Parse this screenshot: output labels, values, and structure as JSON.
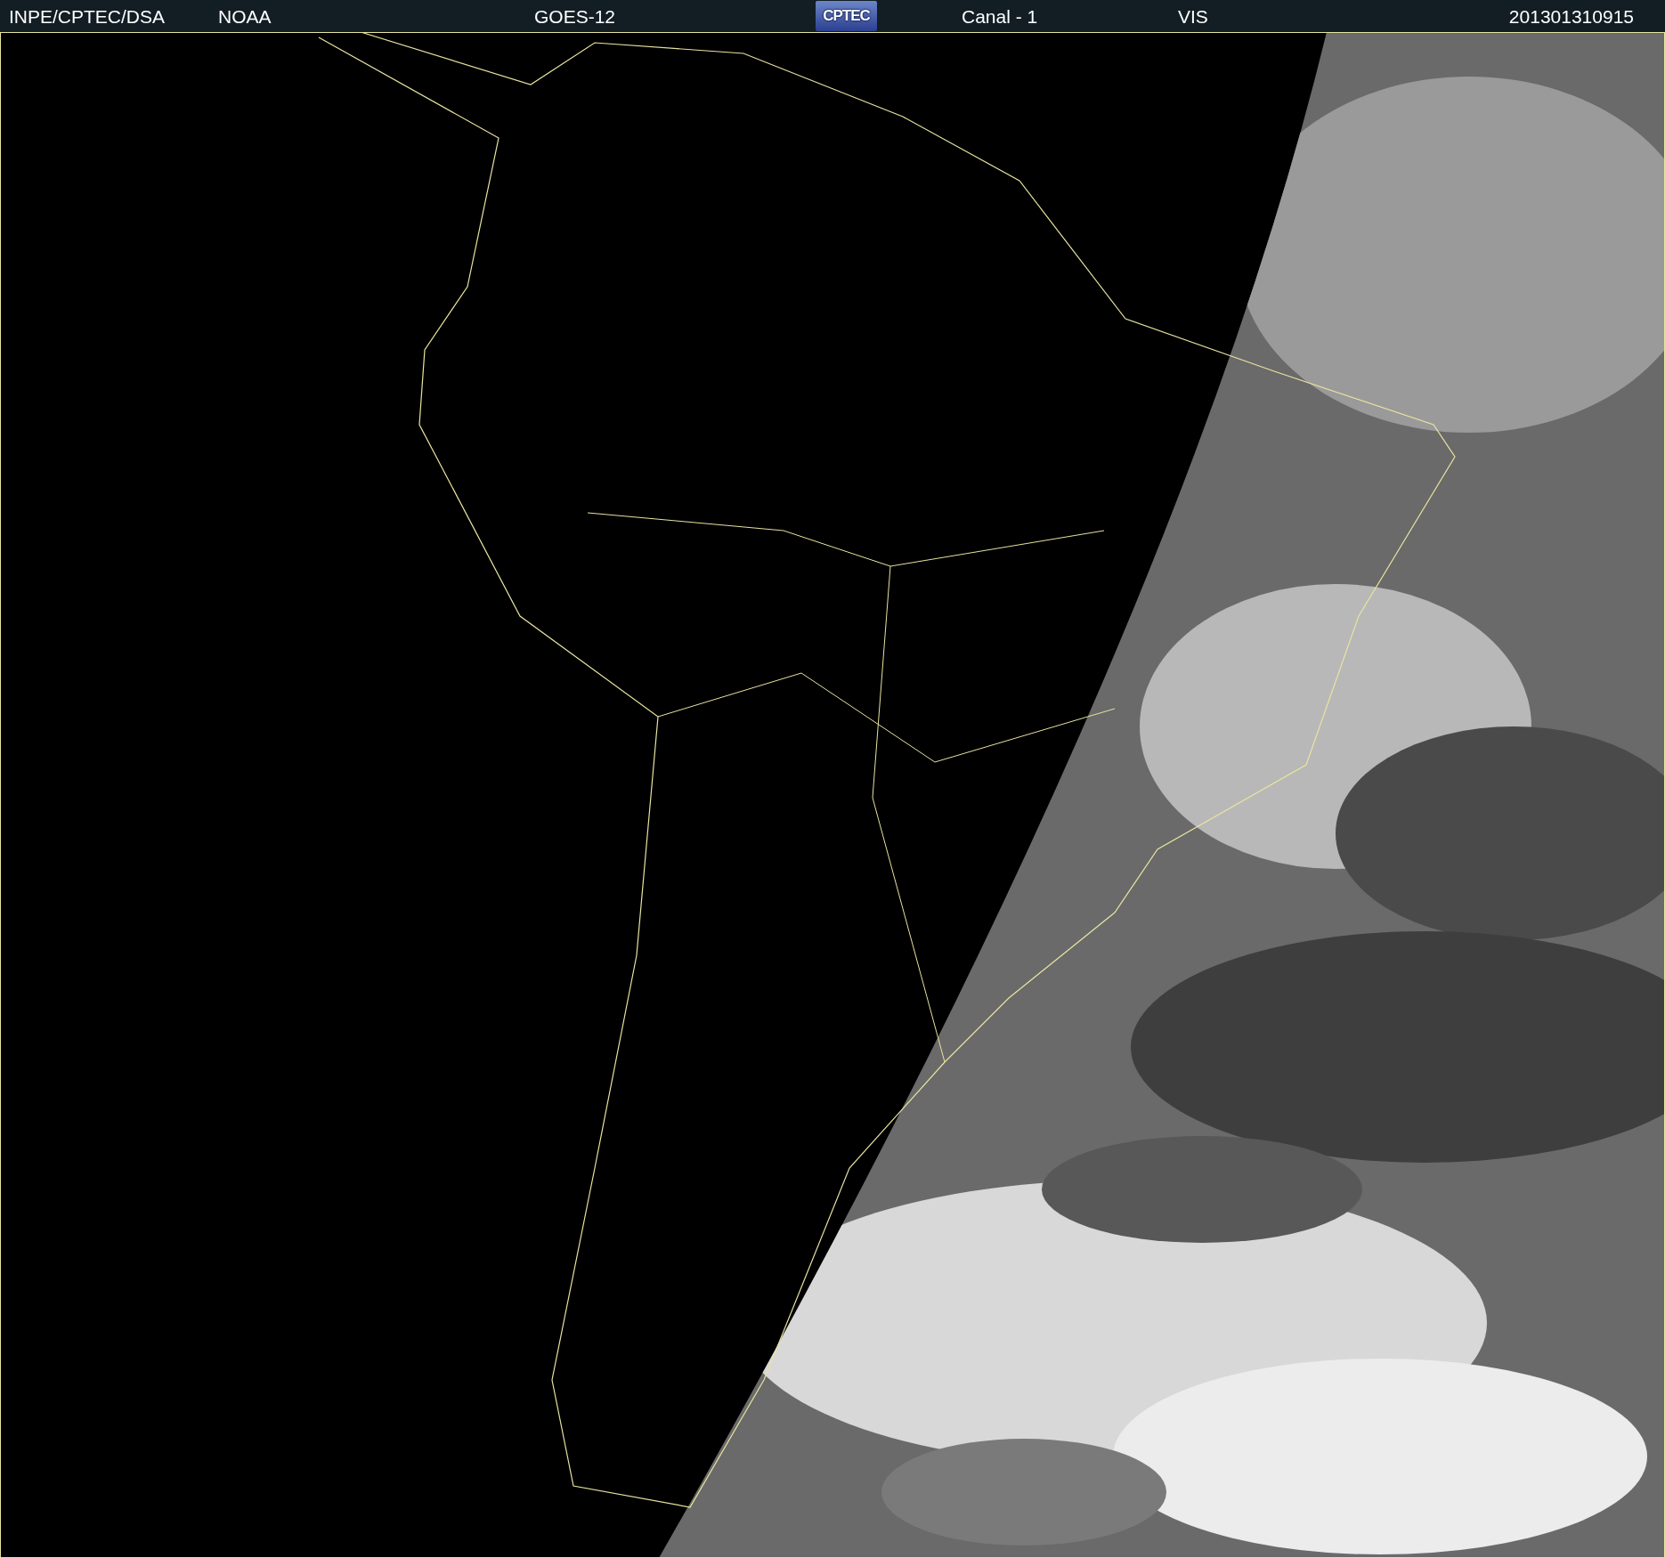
{
  "header": {
    "items": [
      {
        "kind": "text",
        "text": "INPE/CPTEC/DSA"
      },
      {
        "kind": "text",
        "text": "NOAA"
      },
      {
        "kind": "text",
        "text": "GOES-12"
      },
      {
        "kind": "logo",
        "text": "CPTEC"
      },
      {
        "kind": "text",
        "text": "Canal - 1"
      },
      {
        "kind": "text",
        "text": "VIS"
      },
      {
        "kind": "text",
        "text": "201301310915"
      }
    ]
  }
}
